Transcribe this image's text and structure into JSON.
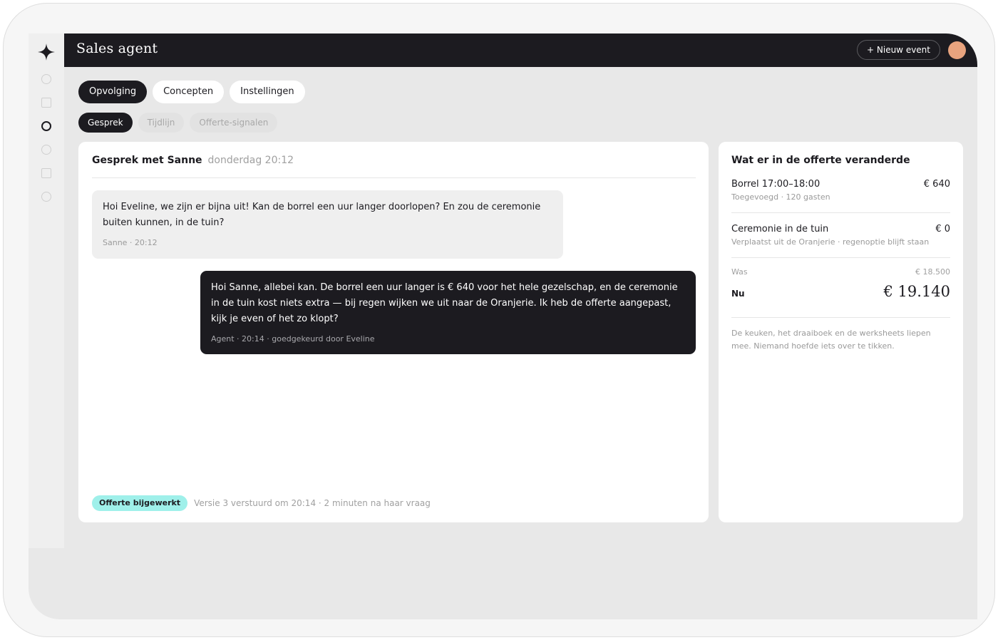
{
  "app": {
    "title": "Sales agent",
    "new_event_label": "+ Nieuw event"
  },
  "colors": {
    "accent_dark": "#1c1b20",
    "badge_bg": "#9ff0ea",
    "avatar": "#e8a37e"
  },
  "icons": {
    "logo": "sparkle-icon"
  },
  "tabs": [
    {
      "label": "Opvolging",
      "active": true
    },
    {
      "label": "Concepten",
      "active": false
    },
    {
      "label": "Instellingen",
      "active": false
    }
  ],
  "subtabs": [
    {
      "label": "Gesprek",
      "active": true
    },
    {
      "label": "Tijdlijn",
      "active": false
    },
    {
      "label": "Offerte-signalen",
      "active": false
    }
  ],
  "chat": {
    "header_name": "Gesprek met Sanne",
    "header_time": "donderdag 20:12",
    "messages": [
      {
        "direction": "in",
        "text": "Hoi Eveline, we zijn er bijna uit! Kan de borrel een uur langer doorlopen? En zou de ceremonie buiten kunnen, in de tuin?",
        "meta": "Sanne · 20:12"
      },
      {
        "direction": "out",
        "text": "Hoi Sanne, allebei kan. De borrel een uur langer is € 640 voor het hele gezelschap, en de ceremonie in de tuin kost niets extra — bij regen wijken we uit naar de Oranjerie. Ik heb de offerte aangepast, kijk je even of het zo klopt?",
        "meta": "Agent · 20:14 · goedgekeurd door Eveline"
      }
    ],
    "status_badge": "Offerte bijgewerkt",
    "footer_note": "Versie 3 verstuurd om 20:14 · 2 minuten na haar vraag"
  },
  "changes": {
    "title": "Wat er in de offerte veranderde",
    "items": [
      {
        "name": "Borrel 17:00–18:00",
        "amount": "€ 640",
        "detail": "Toegevoegd · 120 gasten"
      },
      {
        "name": "Ceremonie in de tuin",
        "amount": "€ 0",
        "detail": "Verplaatst uit de Oranjerie · regenoptie blijft staan"
      }
    ],
    "was_label": "Was",
    "was_value": "€ 18.500",
    "now_label": "Nu",
    "now_value": "€ 19.140",
    "note": "De keuken, het draaiboek en de werksheets liepen mee. Niemand hoefde iets over te tikken."
  }
}
